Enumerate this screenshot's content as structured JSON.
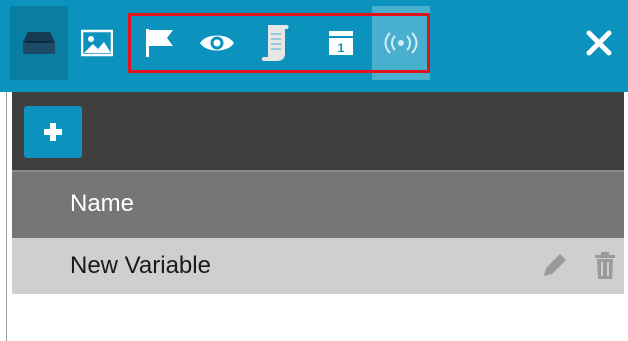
{
  "toolbar": {
    "tabs": [
      {
        "icon": "drive-icon",
        "active": true
      },
      {
        "icon": "image-icon"
      },
      {
        "icon": "flag-icon"
      },
      {
        "icon": "eye-icon"
      },
      {
        "icon": "script-icon"
      },
      {
        "icon": "calendar-icon",
        "badge": "1"
      },
      {
        "icon": "broadcast-icon",
        "selected": true
      }
    ],
    "close_icon": "close-icon",
    "accent_color": "#0c93bd",
    "highlight_color": "#e4121b"
  },
  "panel": {
    "add_icon": "plus-icon",
    "table": {
      "columns": [
        "Name"
      ],
      "rows": [
        {
          "name": "New Variable",
          "actions": [
            "edit-icon",
            "delete-icon"
          ]
        }
      ]
    }
  }
}
